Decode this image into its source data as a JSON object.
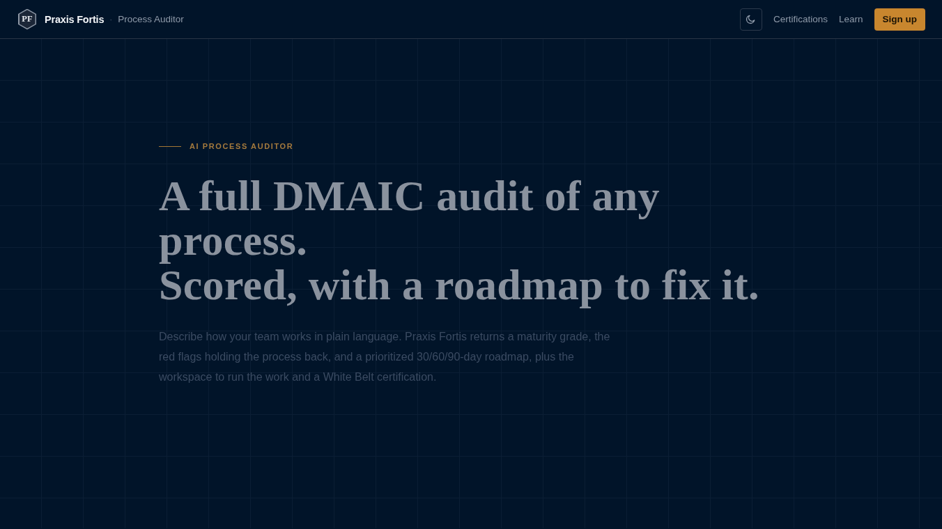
{
  "header": {
    "brand": {
      "logo_text": "PF",
      "name": "Praxis Fortis",
      "separator": "·",
      "product": "Process Auditor"
    },
    "nav": [
      {
        "label": "Certifications"
      },
      {
        "label": "Learn"
      }
    ],
    "cta": "Sign up"
  },
  "hero": {
    "eyebrow": "AI PROCESS AUDITOR",
    "headline": [
      "A full DMAIC audit of any process.",
      "Scored, with a roadmap to fix it."
    ],
    "body": "Describe how your team works in plain language. Praxis Fortis returns a maturity grade, the red flags holding the process back, and a prioritized 30/60/90-day roadmap, plus the workspace to run the work and a White Belt certification."
  }
}
